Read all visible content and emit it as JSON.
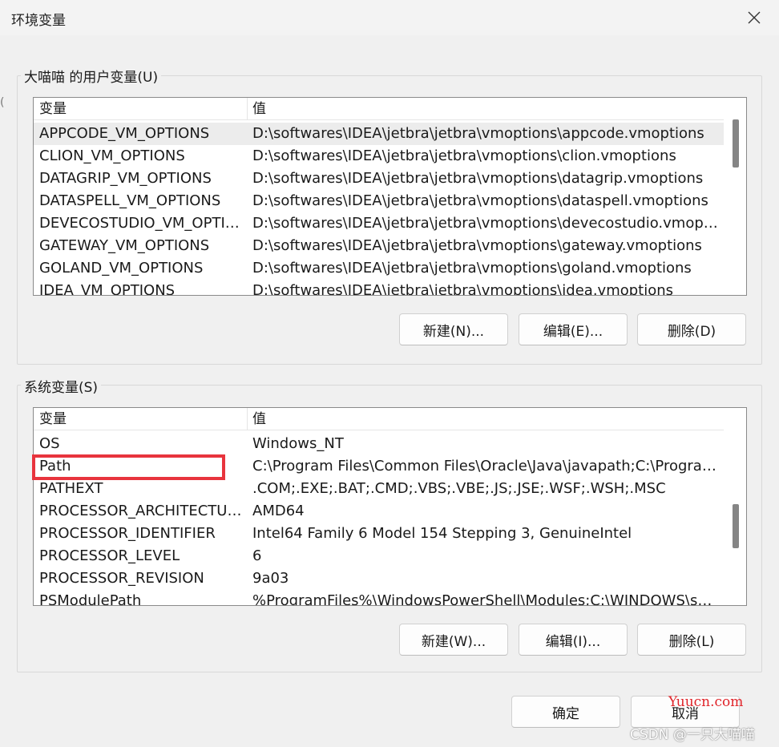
{
  "window": {
    "title": "环境变量"
  },
  "user_vars": {
    "group_label": "大喵喵 的用户变量(U)",
    "columns": [
      "变量",
      "值"
    ],
    "rows": [
      {
        "name": "APPCODE_VM_OPTIONS",
        "value": "D:\\softwares\\IDEA\\jetbra\\jetbra\\vmoptions\\appcode.vmoptions",
        "selected": true
      },
      {
        "name": "CLION_VM_OPTIONS",
        "value": "D:\\softwares\\IDEA\\jetbra\\jetbra\\vmoptions\\clion.vmoptions"
      },
      {
        "name": "DATAGRIP_VM_OPTIONS",
        "value": "D:\\softwares\\IDEA\\jetbra\\jetbra\\vmoptions\\datagrip.vmoptions"
      },
      {
        "name": "DATASPELL_VM_OPTIONS",
        "value": "D:\\softwares\\IDEA\\jetbra\\jetbra\\vmoptions\\dataspell.vmoptions"
      },
      {
        "name": "DEVECOSTUDIO_VM_OPTIO...",
        "value": "D:\\softwares\\IDEA\\jetbra\\jetbra\\vmoptions\\devecostudio.vmoptio..."
      },
      {
        "name": "GATEWAY_VM_OPTIONS",
        "value": "D:\\softwares\\IDEA\\jetbra\\jetbra\\vmoptions\\gateway.vmoptions"
      },
      {
        "name": "GOLAND_VM_OPTIONS",
        "value": "D:\\softwares\\IDEA\\jetbra\\jetbra\\vmoptions\\goland.vmoptions"
      },
      {
        "name": "IDEA_VM_OPTIONS",
        "value": "D:\\softwares\\IDEA\\jetbra\\jetbra\\vmoptions\\idea.vmoptions"
      }
    ],
    "buttons": {
      "new": "新建(N)...",
      "edit": "编辑(E)...",
      "delete": "删除(D)"
    }
  },
  "system_vars": {
    "group_label": "系统变量(S)",
    "columns": [
      "变量",
      "值"
    ],
    "rows": [
      {
        "name": "OS",
        "value": "Windows_NT"
      },
      {
        "name": "Path",
        "value": "C:\\Program Files\\Common Files\\Oracle\\Java\\javapath;C:\\Program ..."
      },
      {
        "name": "PATHEXT",
        "value": ".COM;.EXE;.BAT;.CMD;.VBS;.VBE;.JS;.JSE;.WSF;.WSH;.MSC"
      },
      {
        "name": "PROCESSOR_ARCHITECTURE",
        "value": "AMD64"
      },
      {
        "name": "PROCESSOR_IDENTIFIER",
        "value": "Intel64 Family 6 Model 154 Stepping 3, GenuineIntel"
      },
      {
        "name": "PROCESSOR_LEVEL",
        "value": "6"
      },
      {
        "name": "PROCESSOR_REVISION",
        "value": "9a03"
      },
      {
        "name": "PSModulePath",
        "value": "%ProgramFiles%\\WindowsPowerShell\\Modules;C:\\WINDOWS\\syst..."
      }
    ],
    "buttons": {
      "new": "新建(W)...",
      "edit": "编辑(I)...",
      "delete": "删除(L)"
    }
  },
  "footer": {
    "ok": "确定",
    "cancel": "取消"
  },
  "watermarks": {
    "site": "Yuucn.com",
    "author": "CSDN @一只大喵喵"
  },
  "colors": {
    "highlight": "#e8343d",
    "selected_row": "#ececec"
  },
  "icons": {
    "close": "close-icon"
  }
}
